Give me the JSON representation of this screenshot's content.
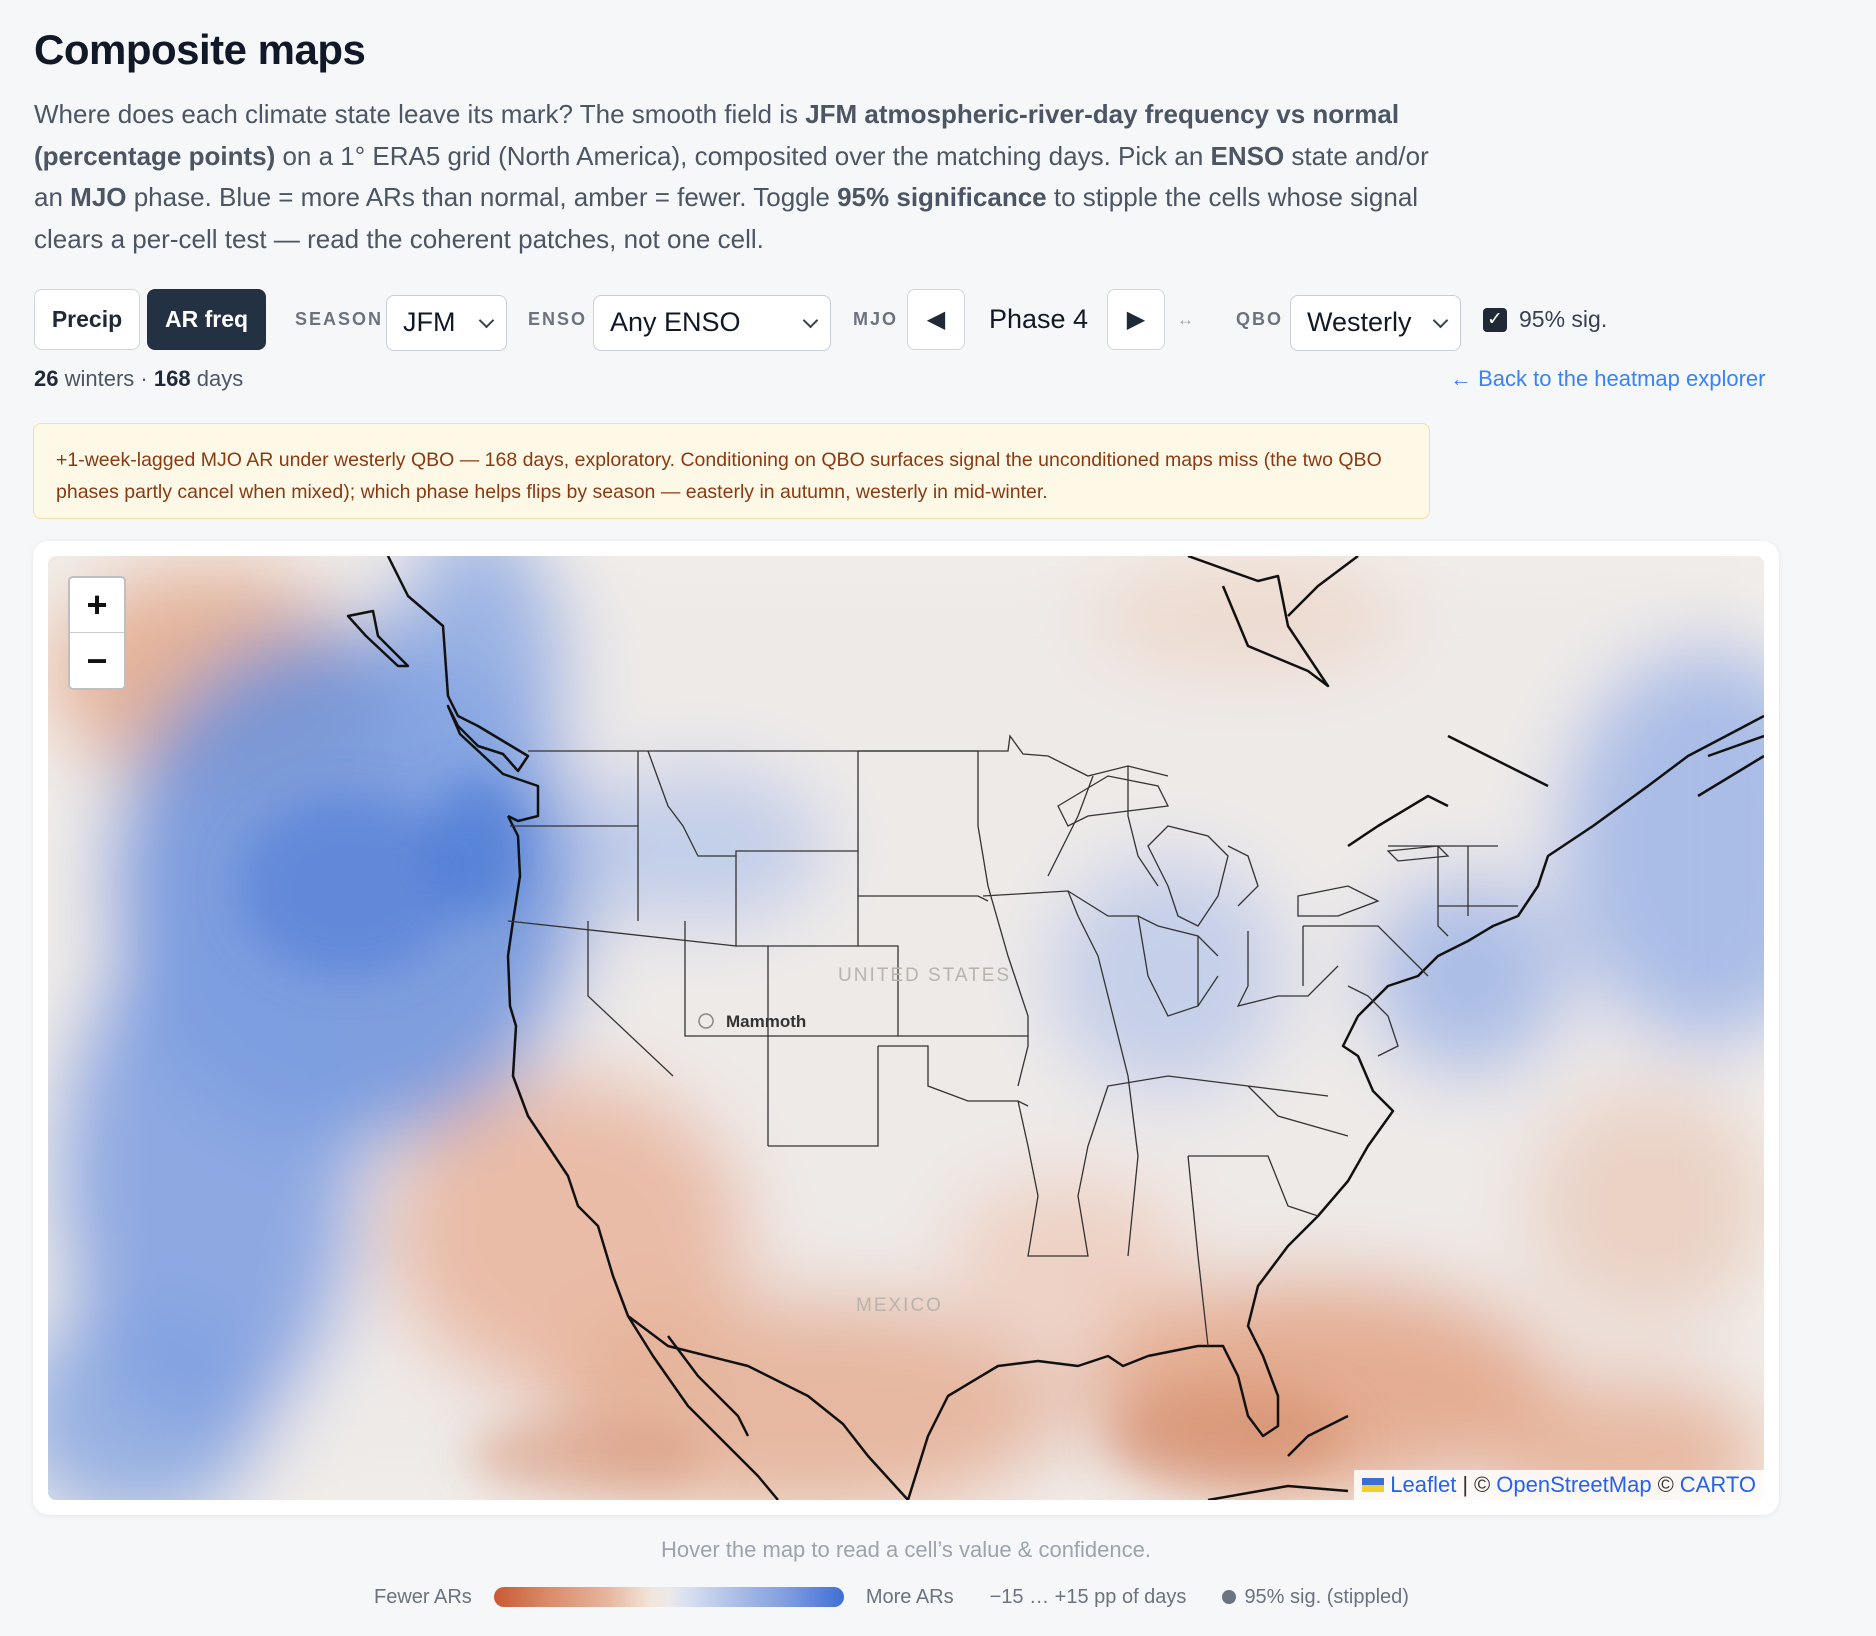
{
  "header": {
    "title": "Composite maps",
    "intro": {
      "p1": "Where does each climate state leave its mark? The smooth field is ",
      "b1": "JFM atmospheric-river-day frequency vs normal (percentage points)",
      "p2": " on a 1° ERA5 grid (North America), composited over the matching days. Pick an ",
      "b2": "ENSO",
      "p3": " state and/or an ",
      "b3": "MJO",
      "p4": " phase. Blue = more ARs than normal, amber = fewer. Toggle ",
      "b4": "95% significance",
      "p5": " to stipple the cells whose signal clears a per-cell test — read the coherent patches, not one cell."
    }
  },
  "controls": {
    "variable_buttons": [
      "Precip",
      "AR freq"
    ],
    "active_variable": "AR freq",
    "season": {
      "label": "SEASON",
      "value": "JFM"
    },
    "enso": {
      "label": "ENSO",
      "value": "Any ENSO"
    },
    "mjo": {
      "label": "MJO",
      "prev": "◀",
      "value": "Phase 4",
      "next": "▶",
      "link": "↔"
    },
    "qbo": {
      "label": "QBO",
      "value": "Westerly"
    },
    "significance": {
      "checked": true,
      "label": "95% sig."
    }
  },
  "counts": {
    "winters": "26",
    "winters_label": "winters",
    "sep": "·",
    "days": "168",
    "days_label": "days"
  },
  "back_link": "← Back to the heatmap explorer",
  "note": "+1-week-lagged MJO AR under westerly QBO — 168 days, exploratory. Conditioning on QBO surfaces signal the unconditioned maps miss (the two QBO phases partly cancel when mixed); which phase helps flips by season — easterly in autumn, westerly in mid-winter.",
  "map": {
    "zoom_in": "+",
    "zoom_out": "−",
    "labels": {
      "country_us": "UNITED STATES",
      "country_mx": "MEXICO",
      "place": "Mammoth"
    },
    "attribution": {
      "leaflet": "Leaflet",
      "sep": "|",
      "copy1": "©",
      "osm": "OpenStreetMap",
      "copy2": "©",
      "carto": "CARTO"
    },
    "colors": {
      "more": "#3f6fd6",
      "fewer": "#c85a34",
      "neutral": "#f3efea",
      "border": "#111111"
    }
  },
  "hover_hint": "Hover the map to read a cell’s value & confidence.",
  "legend": {
    "fewer": "Fewer ARs",
    "more": "More ARs",
    "range": "−15 … +15 pp of days",
    "sig": "95% sig. (stippled)"
  }
}
